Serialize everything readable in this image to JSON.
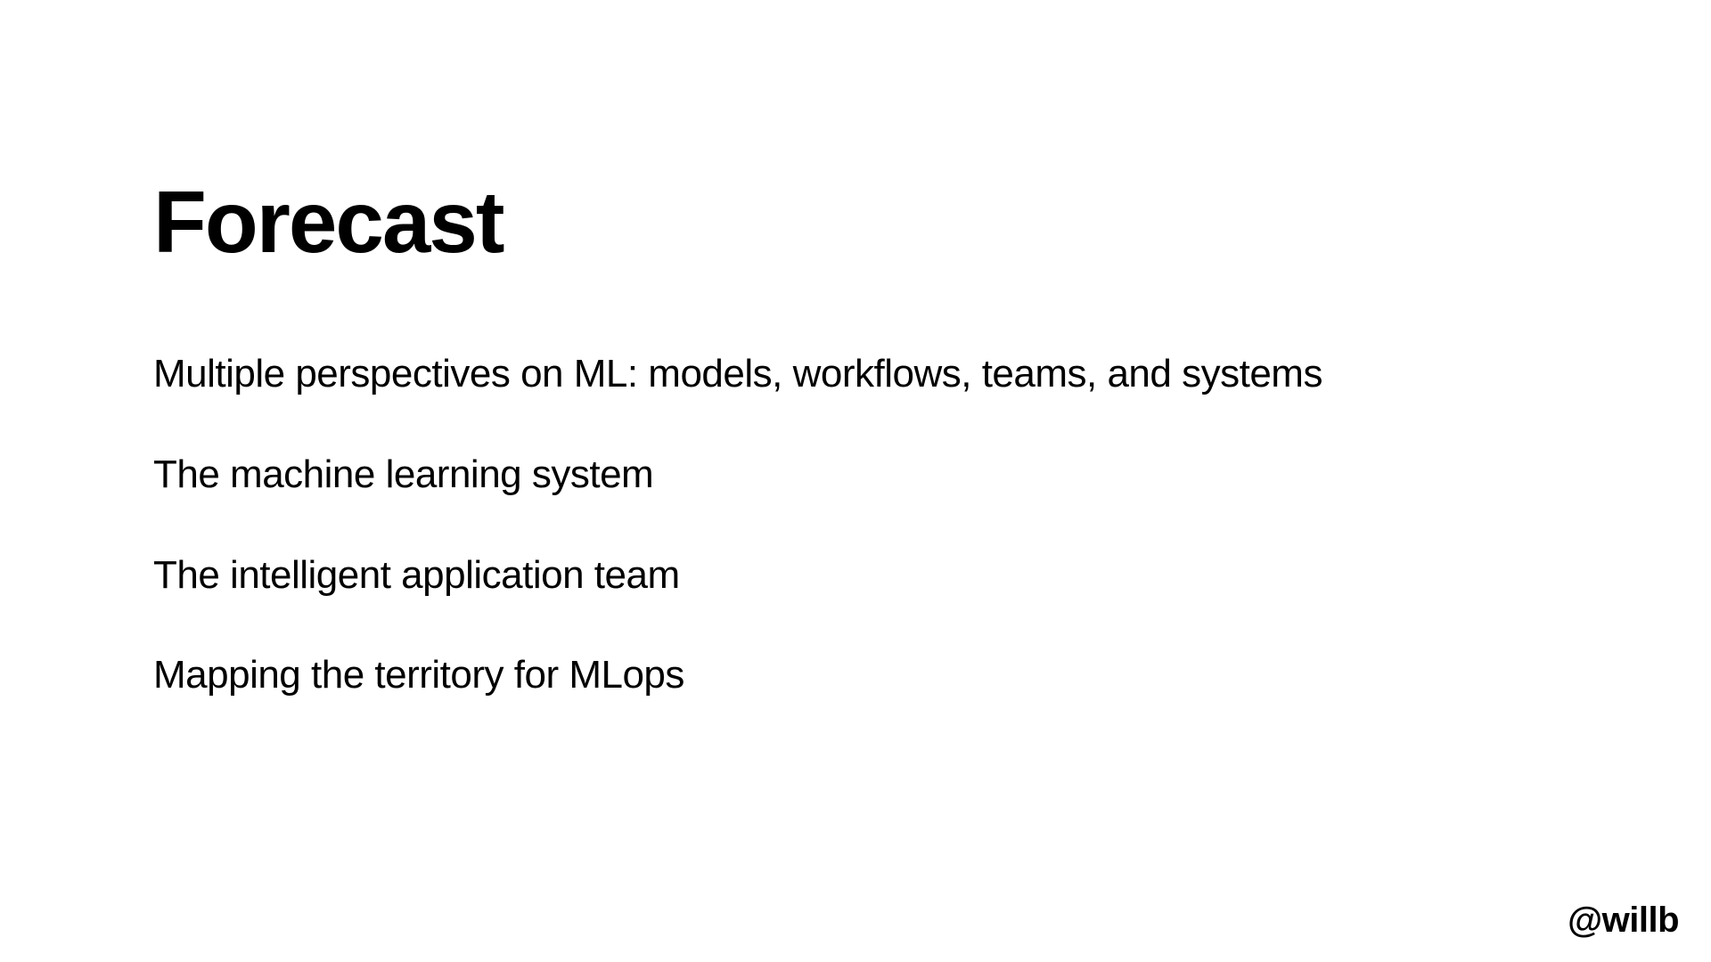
{
  "slide": {
    "title": "Forecast",
    "lines": [
      "Multiple perspectives on ML:  models, workflows, teams, and systems",
      "The machine learning system",
      "The intelligent application team",
      "Mapping the territory for MLops"
    ],
    "handle": "@willb"
  }
}
